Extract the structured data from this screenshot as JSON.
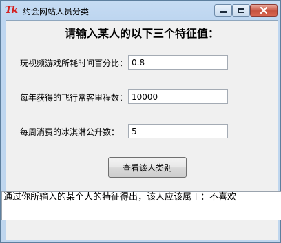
{
  "window": {
    "icon_text": "Tk",
    "title": "约会网站人员分类"
  },
  "form": {
    "heading": "请输入某人的以下三个特征值：",
    "fields": [
      {
        "label": "玩视频游戏所耗时间百分比：",
        "value": "0.8"
      },
      {
        "label": "每年获得的飞行常客里程数：",
        "value": "10000"
      },
      {
        "label": "每周消费的冰淇淋公升数：",
        "value": "5"
      }
    ],
    "submit_label": "查看该人类别"
  },
  "result": {
    "text": "通过你所输入的某个人的特征得出，该人应该属于：不喜欢"
  },
  "colors": {
    "title_gradient_top": "#c6dcf3",
    "client_bg": "#f0f0f0",
    "close_button": "#c7523f",
    "icon_red": "#d42020"
  }
}
